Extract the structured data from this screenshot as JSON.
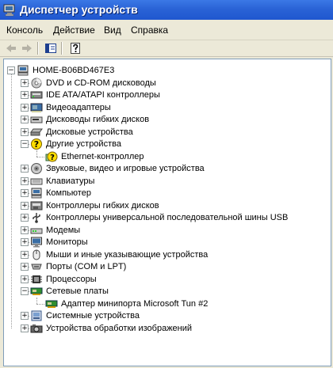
{
  "window": {
    "title": "Диспетчер устройств"
  },
  "menu": {
    "items": [
      {
        "label": "Консоль"
      },
      {
        "label": "Действие"
      },
      {
        "label": "Вид"
      },
      {
        "label": "Справка"
      }
    ]
  },
  "toolbar": {
    "buttons": [
      "back-icon",
      "forward-icon",
      "properties-pane-icon",
      "help-icon"
    ]
  },
  "tree": {
    "root": {
      "label": "HOME-B06BD467E3"
    },
    "categories": [
      {
        "label": "DVD и CD-ROM дисководы",
        "icon": "cdrom-icon",
        "expanded": false
      },
      {
        "label": "IDE ATA/ATAPI контроллеры",
        "icon": "ide-controller-icon",
        "expanded": false
      },
      {
        "label": "Видеоадаптеры",
        "icon": "display-adapter-icon",
        "expanded": false
      },
      {
        "label": "Дисководы гибких дисков",
        "icon": "floppy-drive-icon",
        "expanded": false
      },
      {
        "label": "Дисковые устройства",
        "icon": "disk-drive-icon",
        "expanded": false
      },
      {
        "label": "Другие устройства",
        "icon": "unknown-device-icon",
        "expanded": true,
        "children": [
          {
            "label": "Ethernet-контроллер",
            "icon": "warning-device-icon"
          }
        ]
      },
      {
        "label": "Звуковые, видео и игровые устройства",
        "icon": "sound-icon",
        "expanded": false
      },
      {
        "label": "Клавиатуры",
        "icon": "keyboard-icon",
        "expanded": false
      },
      {
        "label": "Компьютер",
        "icon": "computer-icon",
        "expanded": false
      },
      {
        "label": "Контроллеры гибких дисков",
        "icon": "floppy-controller-icon",
        "expanded": false
      },
      {
        "label": "Контроллеры универсальной последовательной шины USB",
        "icon": "usb-icon",
        "expanded": false
      },
      {
        "label": "Модемы",
        "icon": "modem-icon",
        "expanded": false
      },
      {
        "label": "Мониторы",
        "icon": "monitor-icon",
        "expanded": false
      },
      {
        "label": "Мыши и иные указывающие устройства",
        "icon": "mouse-icon",
        "expanded": false
      },
      {
        "label": "Порты (COM и LPT)",
        "icon": "port-icon",
        "expanded": false
      },
      {
        "label": "Процессоры",
        "icon": "processor-icon",
        "expanded": false
      },
      {
        "label": "Сетевые платы",
        "icon": "network-adapter-icon",
        "expanded": true,
        "children": [
          {
            "label": "Адаптер минипорта Microsoft Tun #2",
            "icon": "network-card-icon"
          }
        ]
      },
      {
        "label": "Системные устройства",
        "icon": "system-device-icon",
        "expanded": false
      },
      {
        "label": "Устройства обработки изображений",
        "icon": "imaging-device-icon",
        "expanded": false
      }
    ]
  }
}
